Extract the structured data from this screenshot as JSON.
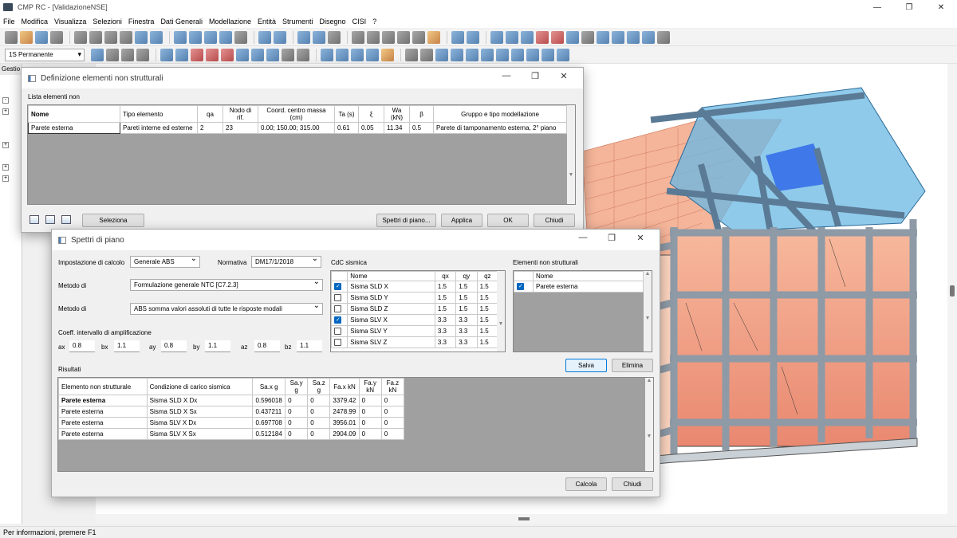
{
  "app": {
    "title": "CMP RC - [ValidazioneNSE]",
    "minimize": "—",
    "restore": "❐",
    "close": "✕"
  },
  "menu": [
    "File",
    "Modifica",
    "Visualizza",
    "Selezioni",
    "Finestra",
    "Dati Generali",
    "Modellazione",
    "Entità",
    "Strumenti",
    "Disegno",
    "CISI",
    "?"
  ],
  "toolbar": {
    "load_combo": "1S Permanente"
  },
  "left_panel": {
    "tab": "Gestio"
  },
  "status": "Per informazioni, premere F1",
  "dlg1": {
    "title": "Definizione elementi non strutturali",
    "list_label": "Lista elementi non",
    "columns": [
      "Nome",
      "Tipo elemento",
      "qa",
      "Nodo di rif.",
      "Coord. centro massa (cm)",
      "Ta (s)",
      "ξ",
      "Wa (kN)",
      "β",
      "Gruppo e tipo modellazione"
    ],
    "rows": [
      [
        "Parete esterna",
        "Pareti interne ed esterne",
        "2",
        "23",
        "0.00; 150.00; 315.00",
        "0.61",
        "0.05",
        "11.34",
        "0.5",
        "Parete di tamponamento esterna, 2° piano"
      ]
    ],
    "buttons": {
      "seleziona": "Seleziona",
      "spettri": "Spettri di piano...",
      "applica": "Applica",
      "ok": "OK",
      "chiudi": "Chiudi"
    }
  },
  "dlg2": {
    "title": "Spettri di piano",
    "impostazione_label": "Impostazione di calcolo",
    "impostazione_value": "Generale ABS",
    "normativa_label": "Normativa",
    "normativa_value": "DM17/1/2018",
    "metodo1_label": "Metodo di",
    "metodo1_value": "Formulazione generale NTC [C7.2.3]",
    "metodo2_label": "Metodo di",
    "metodo2_value": "ABS somma valori assoluti di tutte le risposte modali",
    "coeff_label": "Coeff. intervallo di amplificazione",
    "coeffs": [
      {
        "l": "ax",
        "v": "0.8"
      },
      {
        "l": "bx",
        "v": "1.1"
      },
      {
        "l": "ay",
        "v": "0.8"
      },
      {
        "l": "by",
        "v": "1.1"
      },
      {
        "l": "az",
        "v": "0.8"
      },
      {
        "l": "bz",
        "v": "1.1"
      }
    ],
    "cdc_label": "CdC sismica",
    "cdc_columns": [
      "Nome",
      "qx",
      "qy",
      "qz"
    ],
    "cdc_rows": [
      {
        "checked": true,
        "cells": [
          "Sisma SLD X",
          "1.5",
          "1.5",
          "1.5"
        ]
      },
      {
        "checked": false,
        "cells": [
          "Sisma SLD Y",
          "1.5",
          "1.5",
          "1.5"
        ]
      },
      {
        "checked": false,
        "cells": [
          "Sisma SLD Z",
          "1.5",
          "1.5",
          "1.5"
        ]
      },
      {
        "checked": true,
        "cells": [
          "Sisma SLV X",
          "3.3",
          "3.3",
          "1.5"
        ]
      },
      {
        "checked": false,
        "cells": [
          "Sisma SLV Y",
          "3.3",
          "3.3",
          "1.5"
        ]
      },
      {
        "checked": false,
        "cells": [
          "Sisma SLV Z",
          "3.3",
          "3.3",
          "1.5"
        ]
      }
    ],
    "ens_label": "Elementi non strutturali",
    "ens_column": "Nome",
    "ens_rows": [
      {
        "checked": true,
        "name": "Parete esterna"
      }
    ],
    "salva": "Salva",
    "elimina": "Elimina",
    "risultati_label": "Risultati",
    "res_columns": [
      "Elemento non strutturale",
      "Condizione di carico sismica",
      "Sa.x g",
      "Sa.y g",
      "Sa.z g",
      "Fa.x kN",
      "Fa.y kN",
      "Fa.z kN"
    ],
    "res_rows": [
      [
        "Parete esterna",
        "Sisma SLD X Dx",
        "0.596018",
        "0",
        "0",
        "3379.42",
        "0",
        "0"
      ],
      [
        "Parete esterna",
        "Sisma SLD X Sx",
        "0.437211",
        "0",
        "0",
        "2478.99",
        "0",
        "0"
      ],
      [
        "Parete esterna",
        "Sisma SLV X Dx",
        "0.697708",
        "0",
        "0",
        "3956.01",
        "0",
        "0"
      ],
      [
        "Parete esterna",
        "Sisma SLV X Sx",
        "0.512184",
        "0",
        "0",
        "2904.09",
        "0",
        "0"
      ]
    ],
    "calcola": "Calcola",
    "chiudi": "Chiudi"
  },
  "colors": {
    "accent": "#0078d7",
    "grid_bg": "#a0a0a0",
    "glass": "#5fb4e6",
    "beam": "#8e9aa6",
    "infill": "#f08a6a"
  }
}
